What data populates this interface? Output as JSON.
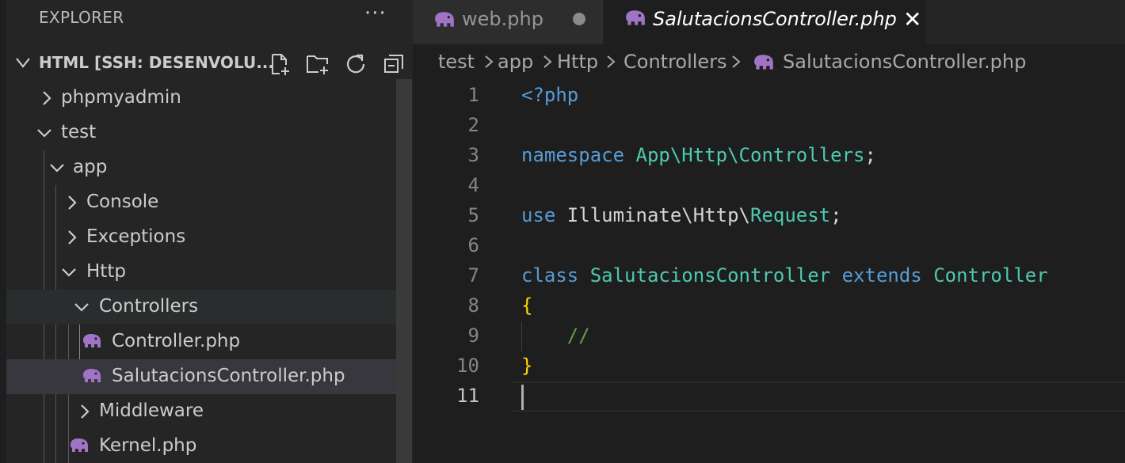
{
  "explorer": {
    "header": "EXPLORER",
    "more": "···",
    "root_title": "HTML [SSH: DESENVOLU...",
    "tree": [
      {
        "label": "phpmyadmin",
        "type": "folder",
        "expanded": false,
        "depth": 0
      },
      {
        "label": "test",
        "type": "folder",
        "expanded": true,
        "depth": 0
      },
      {
        "label": "app",
        "type": "folder",
        "expanded": true,
        "depth": 1
      },
      {
        "label": "Console",
        "type": "folder",
        "expanded": false,
        "depth": 2
      },
      {
        "label": "Exceptions",
        "type": "folder",
        "expanded": false,
        "depth": 2
      },
      {
        "label": "Http",
        "type": "folder",
        "expanded": true,
        "depth": 2
      },
      {
        "label": "Controllers",
        "type": "folder",
        "expanded": true,
        "depth": 3
      },
      {
        "label": "Controller.php",
        "type": "file",
        "depth": 4
      },
      {
        "label": "SalutacionsController.php",
        "type": "file",
        "depth": 4,
        "selected": true
      },
      {
        "label": "Middleware",
        "type": "folder",
        "expanded": false,
        "depth": 3
      },
      {
        "label": "Kernel.php",
        "type": "file",
        "depth": 3
      }
    ]
  },
  "tabs": [
    {
      "label": "web.php",
      "active": false,
      "dirty": true
    },
    {
      "label": "SalutacionsController.php",
      "active": true,
      "close": "✕"
    }
  ],
  "breadcrumb": [
    "test",
    "app",
    "Http",
    "Controllers",
    "SalutacionsController.php"
  ],
  "editor": {
    "lines": [
      {
        "n": "1",
        "tokens": [
          {
            "t": "<?php",
            "c": "kw"
          }
        ]
      },
      {
        "n": "2",
        "tokens": []
      },
      {
        "n": "3",
        "tokens": [
          {
            "t": "namespace ",
            "c": "kw"
          },
          {
            "t": "App\\Http\\Controllers",
            "c": "ty"
          },
          {
            "t": ";",
            "c": "tx"
          }
        ]
      },
      {
        "n": "4",
        "tokens": []
      },
      {
        "n": "5",
        "tokens": [
          {
            "t": "use ",
            "c": "kw"
          },
          {
            "t": "Illuminate\\Http\\",
            "c": "tx"
          },
          {
            "t": "Request",
            "c": "ty"
          },
          {
            "t": ";",
            "c": "tx"
          }
        ]
      },
      {
        "n": "6",
        "tokens": []
      },
      {
        "n": "7",
        "tokens": [
          {
            "t": "class ",
            "c": "kw"
          },
          {
            "t": "SalutacionsController ",
            "c": "ty"
          },
          {
            "t": "extends ",
            "c": "kw"
          },
          {
            "t": "Controller",
            "c": "ty"
          }
        ]
      },
      {
        "n": "8",
        "tokens": [
          {
            "t": "{",
            "c": "br"
          }
        ]
      },
      {
        "n": "9",
        "tokens": [
          {
            "t": "    //",
            "c": "cm"
          }
        ]
      },
      {
        "n": "10",
        "tokens": [
          {
            "t": "}",
            "c": "br"
          }
        ]
      },
      {
        "n": "11",
        "tokens": []
      }
    ],
    "current_line": "11"
  },
  "colors": {
    "php_icon": "#a074c4",
    "keyword": "#569cd6",
    "type": "#4ec9b0",
    "comment": "#6a9955",
    "bracket": "#ffd700"
  }
}
